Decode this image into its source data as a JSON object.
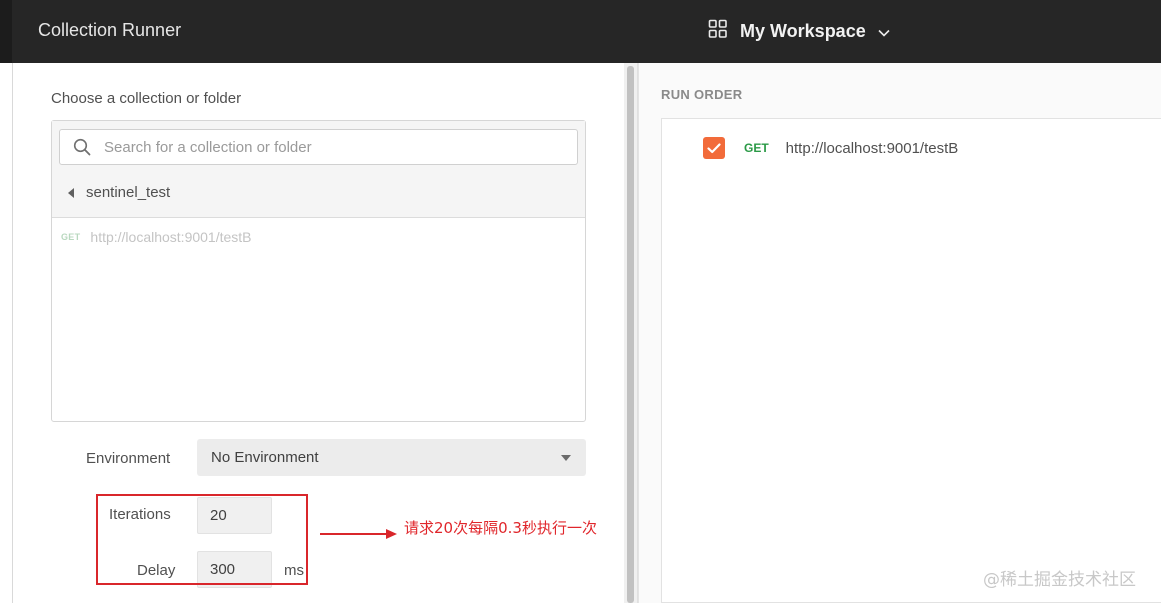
{
  "app": {
    "title": "Collection Runner",
    "workspace_name": "My Workspace",
    "workspace_icon": "grid-icon"
  },
  "left": {
    "choose_label": "Choose a collection or folder",
    "search_placeholder": "Search for a collection or folder",
    "collection_name": "sentinel_test",
    "request": {
      "method": "GET",
      "url": "http://localhost:9001/testB"
    },
    "environment_label": "Environment",
    "environment_value": "No Environment",
    "iterations_label": "Iterations",
    "iterations_value": "20",
    "delay_label": "Delay",
    "delay_value": "300",
    "delay_unit": "ms"
  },
  "annotation": {
    "text": "请求20次每隔0.3秒执行一次",
    "color": "#e0262b"
  },
  "right": {
    "run_order_label": "RUN ORDER",
    "items": [
      {
        "method": "GET",
        "url": "http://localhost:9001/testB",
        "checked": true
      }
    ]
  },
  "watermark": "@稀土掘金技术社区",
  "colors": {
    "accent": "#f26b3a",
    "get_method": "#2b9a47",
    "titlebar": "#262626"
  }
}
